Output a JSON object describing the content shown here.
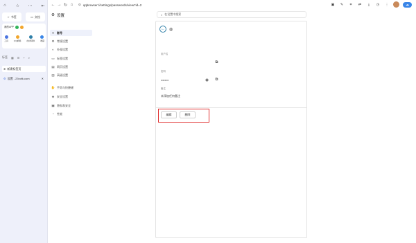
{
  "browser": {
    "left_panel": {
      "top_icons": [
        "home-icon",
        "star-icon",
        "more-icon",
        "panel-toggle-icon"
      ],
      "bookmark_btn": "书签",
      "files_btn": "文档",
      "ext_title": "我的APP",
      "ext_apps": [
        {
          "label": "工具",
          "color": "#4a74e0"
        },
        {
          "label": "QQ邮箱",
          "color": "#f2a62c"
        },
        {
          "label": "在线转换",
          "color": "#2f7fa8"
        },
        {
          "label": "收藏",
          "color": "#3a86e8"
        }
      ],
      "tabs_header": "标签",
      "tabs": [
        {
          "label": "新建标签页"
        },
        {
          "label": "设置 - 23vofk.com"
        }
      ]
    },
    "url": "qqbrowser://settings/passwords/view?id=2"
  },
  "settings": {
    "title": "设置",
    "items": [
      {
        "label": "账号",
        "icon": "person-icon",
        "active": true
      },
      {
        "label": "常规设置",
        "icon": "gear-icon",
        "active": false
      },
      {
        "label": "外观设置",
        "icon": "palette-icon",
        "active": false
      },
      {
        "label": "标签设置",
        "icon": "tab-icon",
        "active": false
      },
      {
        "label": "网页设置",
        "icon": "web-icon",
        "active": false
      },
      {
        "label": "高级设置",
        "icon": "advanced-icon",
        "active": false
      },
      {
        "label": "手势与快捷键",
        "icon": "gesture-icon",
        "active": false
      },
      {
        "label": "安全设置",
        "icon": "shield-icon",
        "active": false
      },
      {
        "label": "隐私和安全",
        "icon": "lock-icon",
        "active": false
      },
      {
        "label": "性能",
        "icon": "performance-icon",
        "active": false
      }
    ]
  },
  "search": {
    "placeholder": "在设置中搜索"
  },
  "password_detail": {
    "username_label": "用户名",
    "username_value": "",
    "password_label": "密码",
    "password_value": "••••••••",
    "note_label": "备注",
    "note_value": "未添加任何备注",
    "edit_button": "编辑",
    "delete_button": "删除"
  }
}
